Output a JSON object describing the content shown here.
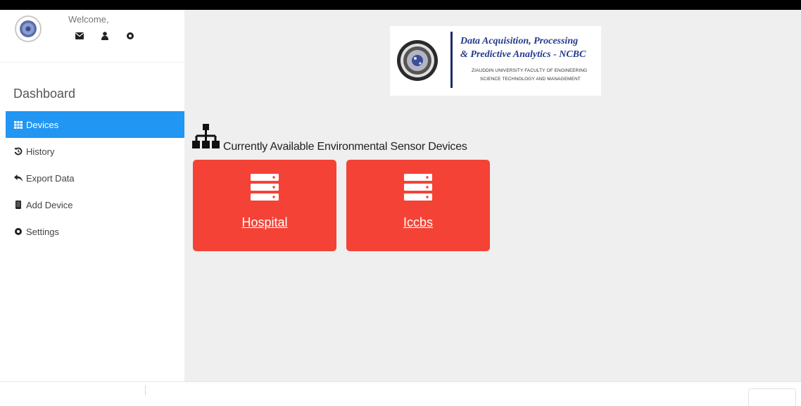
{
  "profile": {
    "welcome": "Welcome,",
    "icons": [
      "envelope-icon",
      "user-icon",
      "gear-icon"
    ]
  },
  "sidebar": {
    "title": "Dashboard",
    "items": [
      {
        "label": "Devices",
        "icon": "table-icon",
        "active": true
      },
      {
        "label": "History",
        "icon": "history-icon",
        "active": false
      },
      {
        "label": "Export Data",
        "icon": "reply-icon",
        "active": false
      },
      {
        "label": "Add Device",
        "icon": "mobile-icon",
        "active": false
      },
      {
        "label": "Settings",
        "icon": "gear-icon",
        "active": false
      }
    ]
  },
  "logo": {
    "line1": "Data Acquisition, Processing",
    "line2": "& Predictive Analytics - NCBC",
    "line3": "ZIAUDDIN UNIVERSITY FACULTY OF ENGINEERING",
    "line4": "SCIENCE TECHNOLOGY AND MANAGEMENT"
  },
  "main": {
    "heading": "Currently Available Environmental Sensor Devices",
    "heading_icon": "sitemap-icon",
    "devices": [
      {
        "label": "Hospital",
        "icon": "server-icon"
      },
      {
        "label": "Iccbs",
        "icon": "server-icon"
      }
    ]
  },
  "colors": {
    "accent": "#2196f3",
    "card": "#f44336",
    "content_bg": "#efefef",
    "logo_text": "#243a8c"
  }
}
